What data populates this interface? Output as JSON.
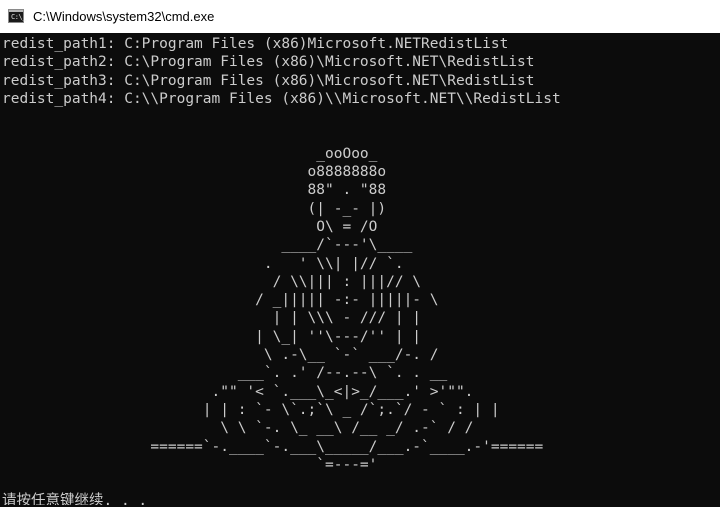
{
  "window": {
    "title": "C:\\Windows\\system32\\cmd.exe",
    "icon": "cmd-icon",
    "icon_text": "C:\\_"
  },
  "console": {
    "lines": [
      "redist_path1: C:Program Files (x86)Microsoft.NETRedistList",
      "redist_path2: C:\\Program Files (x86)\\Microsoft.NET\\RedistList",
      "redist_path3: C:\\Program Files (x86)\\Microsoft.NET\\RedistList",
      "redist_path4: C:\\\\Program Files (x86)\\\\Microsoft.NET\\\\RedistList",
      "",
      "",
      "                                    _ooOoo_",
      "                                   o8888888o",
      "                                   88\" . \"88",
      "                                   (| -_- |)",
      "                                    O\\ = /O",
      "                                ____/`---'\\____",
      "                              .   ' \\\\| |// `.",
      "                               / \\\\||| : |||// \\",
      "                             / _||||| -:- |||||- \\",
      "                               | | \\\\\\ - /// | |",
      "                             | \\_| ''\\---/'' | |",
      "                              \\ .-\\__ `-` ___/-. /",
      "                           ___`. .' /--.--\\ `. . __",
      "                        .\"\" '< `.___\\_<|>_/___.' >'\"\".",
      "                       | | : `- \\`.;`\\ _ /`;.`/ - ` : | |",
      "                         \\ \\ `-. \\_ __\\ /__ _/ .-` / /",
      "                 ======`-.____`-.___\\_____/___.-`____.-'======",
      "                                    `=---='",
      "",
      "请按任意键继续. . ."
    ]
  }
}
